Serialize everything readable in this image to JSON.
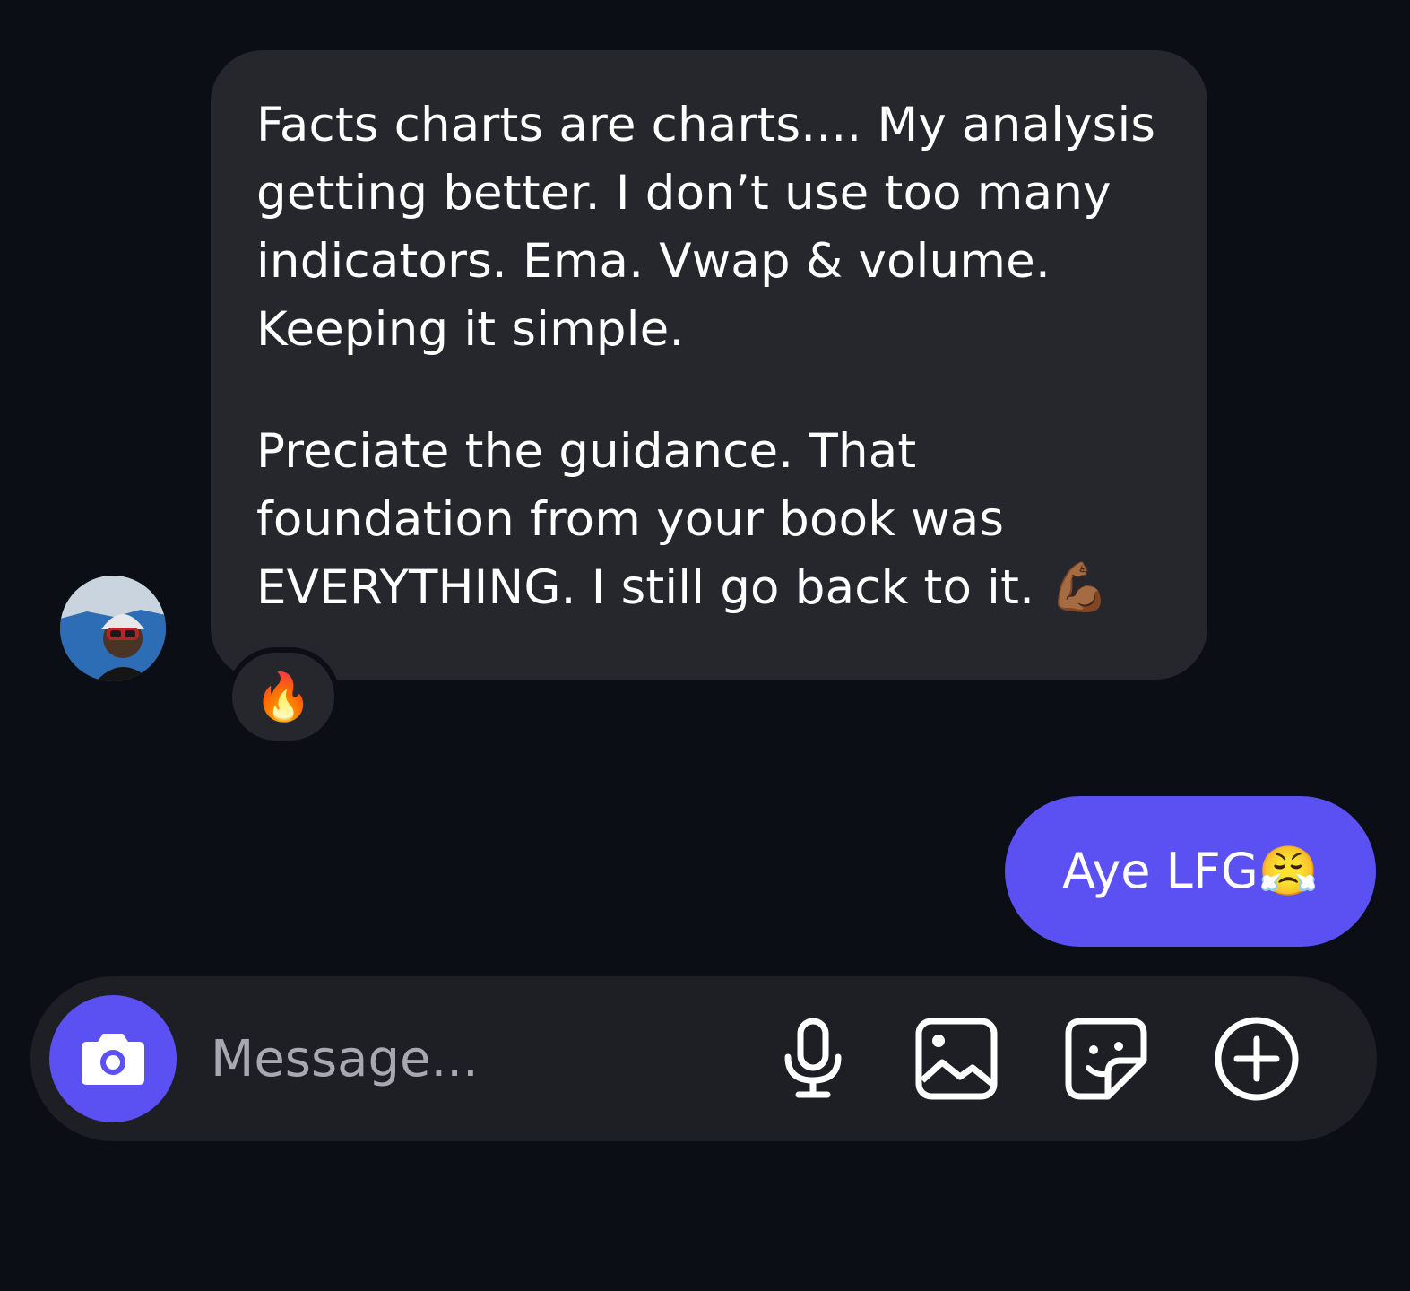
{
  "conversation": {
    "incoming": {
      "paragraphs": [
        "Facts charts are charts.... My analysis getting better. I don’t use too many indicators. Ema. Vwap & volume. Keeping it simple.",
        "Preciate the guidance. That foundation from your book was EVERYTHING. I still go back to it. 💪🏾"
      ],
      "reaction": "🔥"
    },
    "outgoing": {
      "text": "Aye LFG😤"
    }
  },
  "composer": {
    "placeholder": "Message...",
    "value": "",
    "icons": [
      "camera-icon",
      "microphone-icon",
      "image-icon",
      "sticker-icon",
      "add-icon"
    ]
  },
  "colors": {
    "background": "#0b0e14",
    "incoming_bubble": "#25272d",
    "outgoing_bubble": "#5b51f2",
    "composer": "#1d1f25",
    "accent": "#5b51f2",
    "placeholder": "#a7a9b0"
  }
}
